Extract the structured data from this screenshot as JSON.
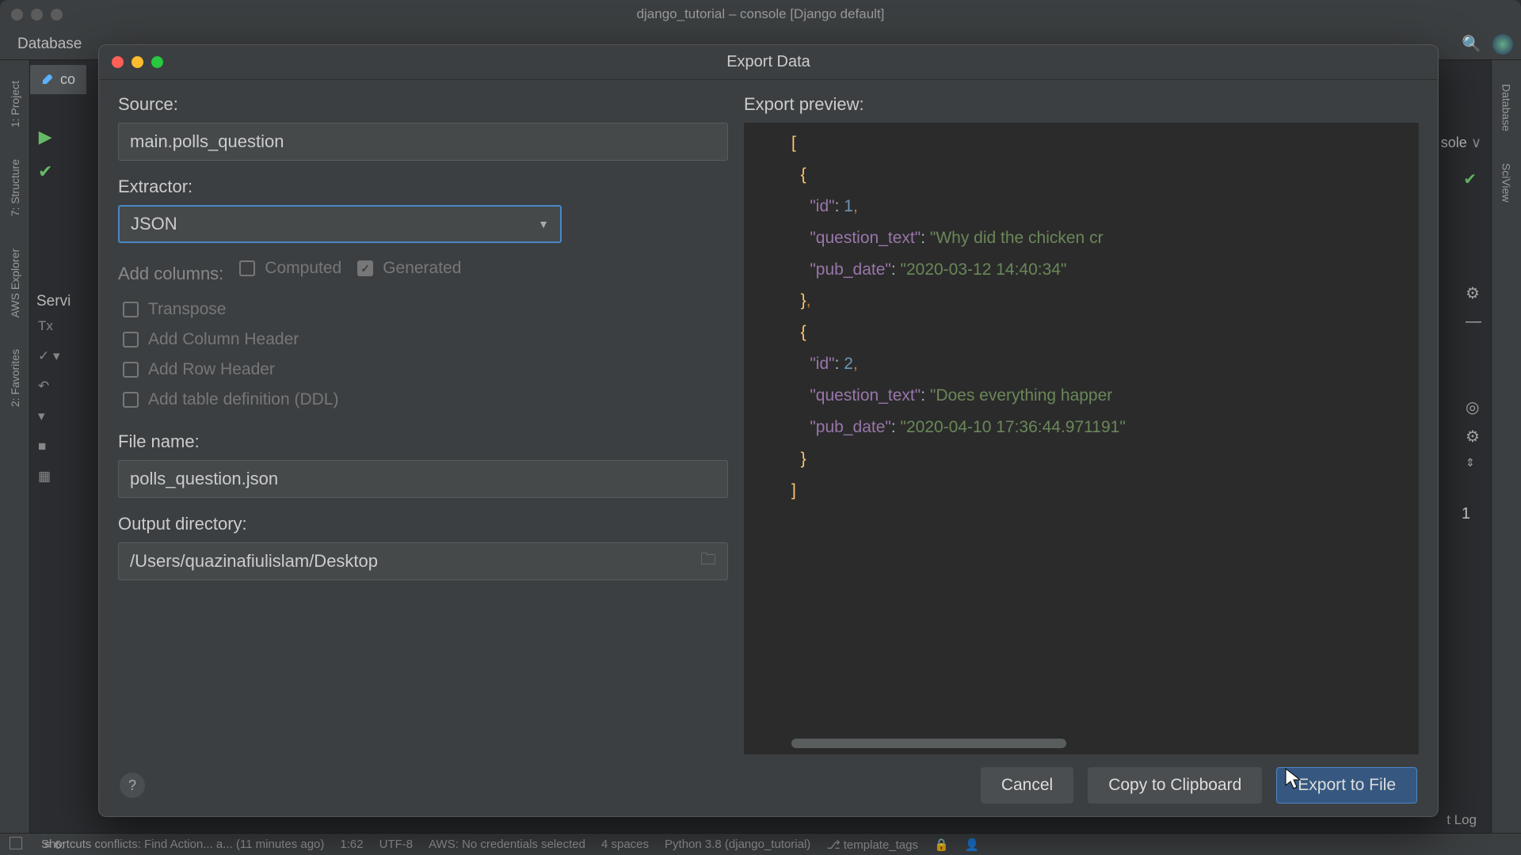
{
  "window": {
    "title": "django_tutorial – console [Django default]"
  },
  "toolbar": {
    "left_label": "Database"
  },
  "left_tabs": [
    "1: Project",
    "7: Structure",
    "AWS Explorer",
    "2: Favorites"
  ],
  "right_tabs": [
    "Database",
    "SciView"
  ],
  "editor": {
    "tab_label": "co"
  },
  "background": {
    "sole_label": "sole",
    "services_label": "Servi",
    "one_label": "1",
    "log_label": "t Log"
  },
  "dialog": {
    "title": "Export Data",
    "labels": {
      "source": "Source:",
      "extractor": "Extractor:",
      "addcolumns": "Add columns:",
      "computed": "Computed",
      "generated": "Generated",
      "transpose": "Transpose",
      "addcolheader": "Add Column Header",
      "addrowheader": "Add Row Header",
      "addddl": "Add table definition (DDL)",
      "filename": "File name:",
      "outputdir": "Output directory:",
      "preview": "Export preview:"
    },
    "values": {
      "source": "main.polls_question",
      "extractor": "JSON",
      "filename": "polls_question.json",
      "outputdir": "/Users/quazinafiulislam/Desktop"
    },
    "checks": {
      "computed": false,
      "generated": true,
      "transpose": false,
      "addcolheader": false,
      "addrowheader": false,
      "addddl": false
    },
    "buttons": {
      "cancel": "Cancel",
      "copy": "Copy to Clipboard",
      "export": "Export to File"
    },
    "preview_records": [
      {
        "id": 1,
        "question_text": "Why did the chicken cr",
        "pub_date": "2020-03-12 14:40:34"
      },
      {
        "id": 2,
        "question_text": "Does everything happer",
        "pub_date": "2020-04-10 17:36:44.971191"
      }
    ]
  },
  "statusbar": {
    "shortcuts": "Shortcuts conflicts: Find Action... a... (11 minutes ago)",
    "pos": "1:62",
    "enc": "UTF-8",
    "aws": "AWS: No credentials selected",
    "indent": "4 spaces",
    "python": "Python 3.8 (django_tutorial)",
    "branch": "template_tags",
    "linecol": "6:"
  }
}
